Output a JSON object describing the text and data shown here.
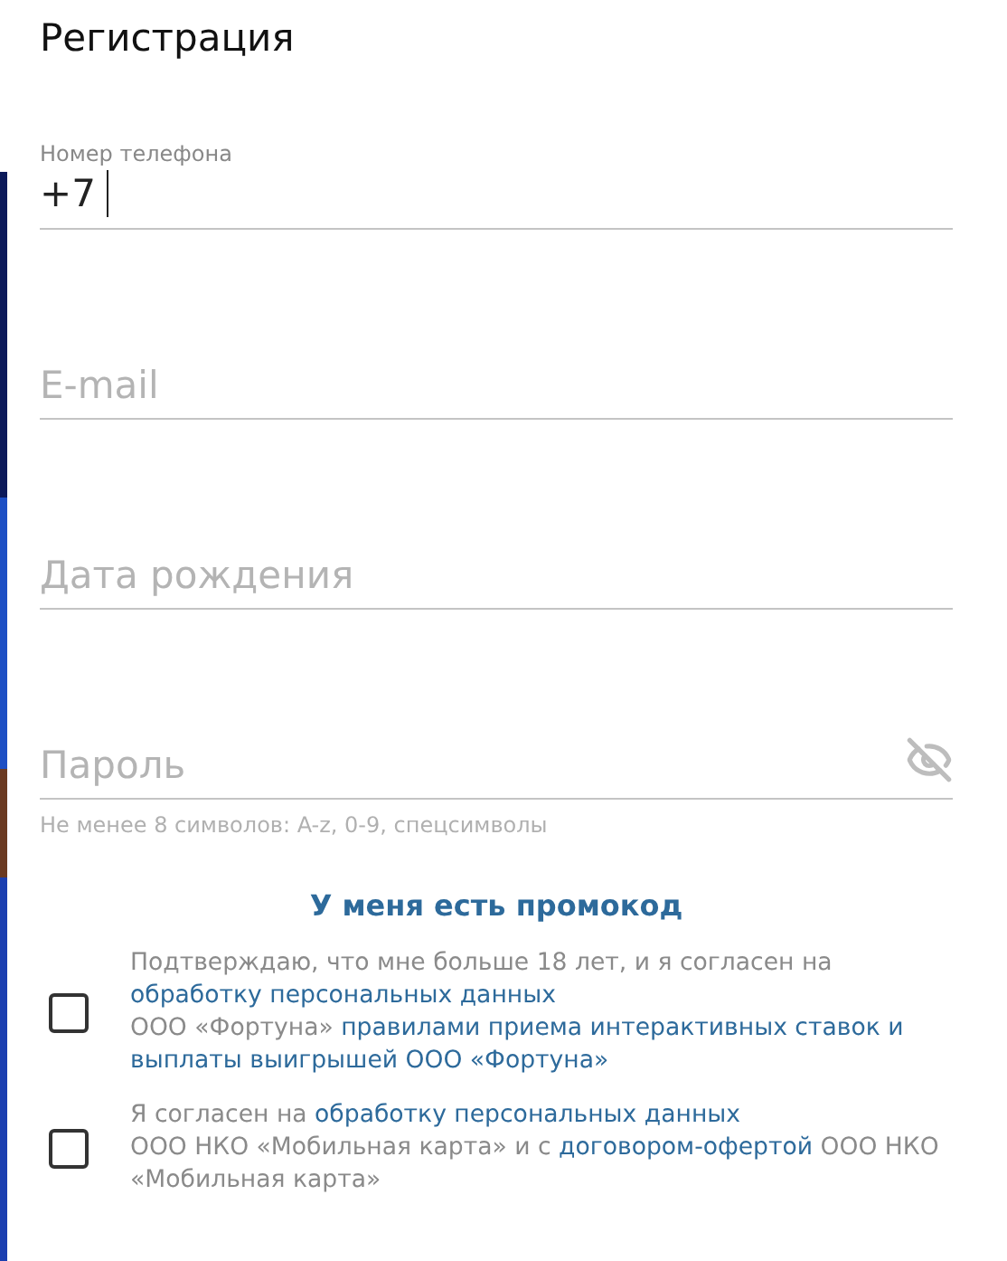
{
  "title": "Регистрация",
  "fields": [
    {
      "kind": "phone",
      "label": "Номер телефона",
      "value": "+7",
      "focused": true
    },
    {
      "kind": "text",
      "placeholder": "E-mail"
    },
    {
      "kind": "text",
      "placeholder": "Дата рождения"
    },
    {
      "kind": "password",
      "placeholder": "Пароль",
      "password_visible": false,
      "hint": "Не менее 8 символов: A-z, 0-9, спецсимволы"
    }
  ],
  "promo_link": "У меня есть промокод",
  "consents": [
    {
      "checked": false,
      "lines": [
        [
          {
            "kind": "text",
            "text": "Подтверждаю, что мне больше 18 лет, и я согласен на"
          }
        ],
        [
          {
            "kind": "link",
            "text": "обработку персональных данных"
          }
        ],
        [
          {
            "kind": "text",
            "text": "ООО «Фортуна»"
          },
          {
            "kind": "link",
            "text": "правилами приема интерактивных ставок и"
          }
        ],
        [
          {
            "kind": "link",
            "text": "выплаты выигрышей ООО «Фортуна»"
          }
        ]
      ]
    },
    {
      "checked": false,
      "lines": [
        [
          {
            "kind": "text",
            "text": "Я согласен на"
          },
          {
            "kind": "link",
            "text": "обработку персональных данных"
          }
        ],
        [
          {
            "kind": "text",
            "text": "ООО НКО «Мобильная карта» и с"
          },
          {
            "kind": "link",
            "text": "договором-офертой"
          },
          {
            "kind": "text",
            "text": "ООО НКО"
          }
        ],
        [
          {
            "kind": "text",
            "text": "«Мобильная карта»"
          }
        ]
      ]
    }
  ]
}
